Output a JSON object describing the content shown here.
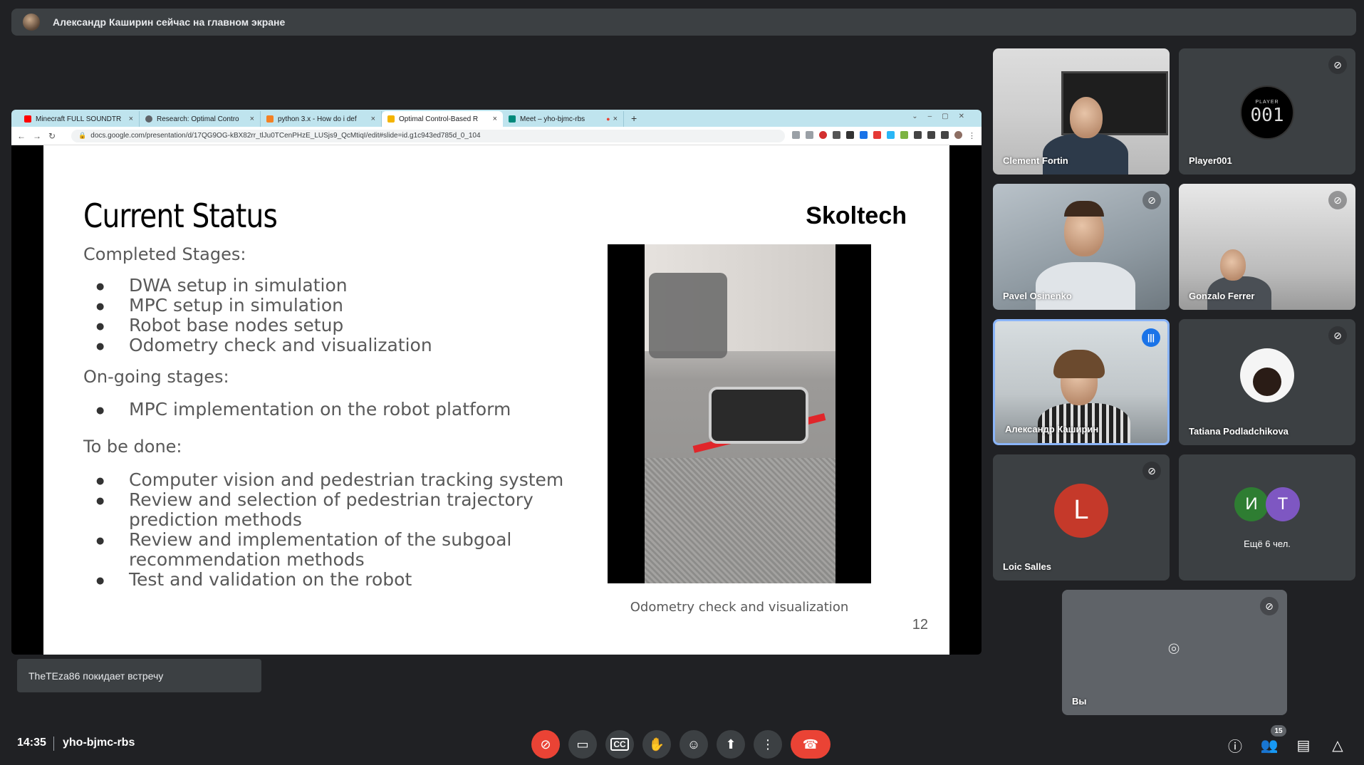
{
  "banner": {
    "text": "Александр Каширин сейчас на главном экране"
  },
  "browser": {
    "tabs": [
      {
        "title": "Minecraft FULL SOUNDTR",
        "icon_color": "#ff0000"
      },
      {
        "title": "Research: Optimal Contro",
        "icon_color": "#5f6368"
      },
      {
        "title": "python 3.x - How do i def",
        "icon_color": "#f48024"
      },
      {
        "title": "Optimal Control-Based R",
        "icon_color": "#f4b400"
      },
      {
        "title": "Meet – yho-bjmc-rbs",
        "icon_color": "#00897b"
      }
    ],
    "url": "docs.google.com/presentation/d/17QG9OG-kBX82rr_tlJu0TCenPHzE_LUSjs9_QcMtiqI/edit#slide=id.g1c943ed785d_0_104"
  },
  "slide": {
    "title": "Current Status",
    "brand": "Skoltech",
    "completed_heading": "Completed Stages:",
    "completed": [
      "DWA setup in simulation",
      "MPC setup in simulation",
      "Robot base nodes setup",
      "Odometry check and visualization"
    ],
    "ongoing_heading": "On-going stages:",
    "ongoing": [
      "MPC implementation on the robot platform"
    ],
    "todo_heading": "To be done:",
    "todo": [
      "Computer vision and pedestrian tracking system",
      "Review and selection of pedestrian trajectory",
      "prediction methods",
      "Review and implementation of the subgoal",
      "recommendation methods",
      "Test and validation on the robot"
    ],
    "caption": "Odometry check and visualization",
    "page_number": "12"
  },
  "participants": [
    {
      "name": "Clement Fortin"
    },
    {
      "name": "Player001",
      "logo_top": "PLAYER",
      "logo_number": "001"
    },
    {
      "name": "Pavel Osinenko"
    },
    {
      "name": "Gonzalo Ferrer"
    },
    {
      "name": "Александр Каширин"
    },
    {
      "name": "Tatiana Podladchikova"
    },
    {
      "name": "Loic Salles",
      "initial": "L",
      "color": "#c5392a"
    },
    {
      "more_text": "Ещё 6 чел.",
      "initial_1": "И",
      "color_1": "#2e7d32",
      "initial_2": "T",
      "color_2": "#7e57c2"
    },
    {
      "name": "Вы"
    }
  ],
  "toast": {
    "text": "TheTEza86 покидает встречу"
  },
  "bottom": {
    "time": "14:35",
    "meeting_code": "yho-bjmc-rbs",
    "participant_count": "15"
  }
}
